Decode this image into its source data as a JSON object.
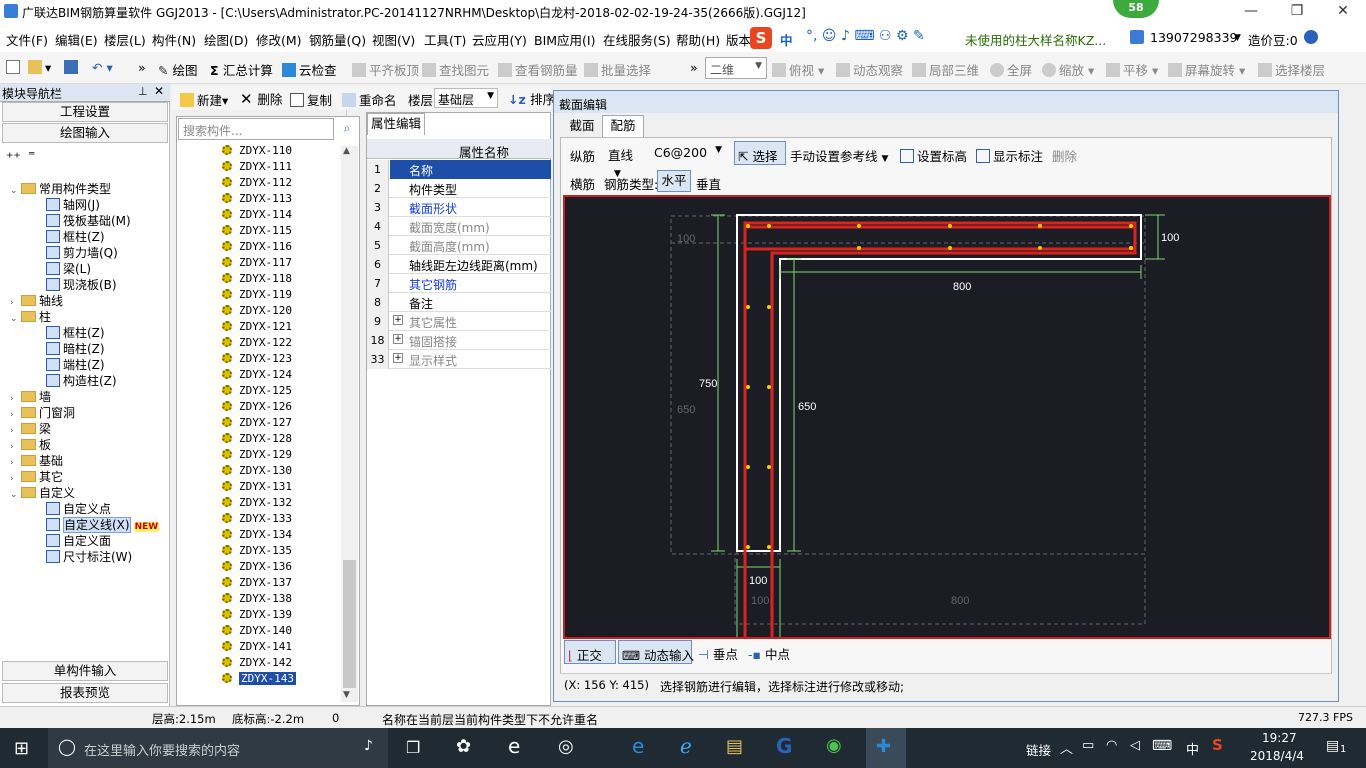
{
  "window": {
    "title": "广联达BIM钢筋算量软件 GGJ2013 - [C:\\Users\\Administrator.PC-20141127NRHM\\Desktop\\白龙村-2018-02-02-19-24-35(2666版).GGJ12]",
    "badge": "58",
    "minimize": "—",
    "maximize": "❐",
    "close": "✕"
  },
  "menu": {
    "items": [
      "文件(F)",
      "编辑(E)",
      "楼层(L)",
      "构件(N)",
      "绘图(D)",
      "修改(M)",
      "钢筋量(Q)",
      "视图(V)",
      "工具(T)",
      "云应用(Y)",
      "BIM应用(I)",
      "在线服务(S)",
      "帮助(H)",
      "版本"
    ],
    "ime_label": "中",
    "notice": "未使用的柱大样名称KZ...",
    "phone": "13907298339",
    "price": "造价豆:0"
  },
  "toolbar": {
    "draw": "绘图",
    "sum": "汇总计算",
    "cloud_check": "云检查",
    "flush_top": "平齐板顶",
    "find": "查找图元",
    "view_rebar": "查看钢筋量",
    "batch_select": "批量选择",
    "view_mode": "二维",
    "top_view": "俯视",
    "dyn_observe": "动态观察",
    "local_3d": "局部三维",
    "fullscreen": "全屏",
    "zoom": "缩放",
    "pan": "平移",
    "rotate": "屏幕旋转",
    "select_floor": "选择楼层"
  },
  "left_panel": {
    "title": "模块导航栏",
    "project_settings": "工程设置",
    "draw_input": "绘图输入",
    "single_input": "单构件输入",
    "report": "报表预览",
    "tree": [
      {
        "label": "常用构件类型",
        "level": 0,
        "kind": "folder",
        "open": true
      },
      {
        "label": "轴网(J)",
        "level": 1,
        "kind": "item"
      },
      {
        "label": "筏板基础(M)",
        "level": 1,
        "kind": "item"
      },
      {
        "label": "框柱(Z)",
        "level": 1,
        "kind": "item"
      },
      {
        "label": "剪力墙(Q)",
        "level": 1,
        "kind": "item"
      },
      {
        "label": "梁(L)",
        "level": 1,
        "kind": "item"
      },
      {
        "label": "现浇板(B)",
        "level": 1,
        "kind": "item"
      },
      {
        "label": "轴线",
        "level": 0,
        "kind": "folder",
        "open": false
      },
      {
        "label": "柱",
        "level": 0,
        "kind": "folder",
        "open": true
      },
      {
        "label": "框柱(Z)",
        "level": 1,
        "kind": "item"
      },
      {
        "label": "暗柱(Z)",
        "level": 1,
        "kind": "item"
      },
      {
        "label": "端柱(Z)",
        "level": 1,
        "kind": "item"
      },
      {
        "label": "构造柱(Z)",
        "level": 1,
        "kind": "item"
      },
      {
        "label": "墙",
        "level": 0,
        "kind": "folder",
        "open": false
      },
      {
        "label": "门窗洞",
        "level": 0,
        "kind": "folder",
        "open": false
      },
      {
        "label": "梁",
        "level": 0,
        "kind": "folder",
        "open": false
      },
      {
        "label": "板",
        "level": 0,
        "kind": "folder",
        "open": false
      },
      {
        "label": "基础",
        "level": 0,
        "kind": "folder",
        "open": false
      },
      {
        "label": "其它",
        "level": 0,
        "kind": "folder",
        "open": false
      },
      {
        "label": "自定义",
        "level": 0,
        "kind": "folder",
        "open": true
      },
      {
        "label": "自定义点",
        "level": 1,
        "kind": "item"
      },
      {
        "label": "自定义线(X)",
        "level": 1,
        "kind": "item",
        "selected": true
      },
      {
        "label": "自定义面",
        "level": 1,
        "kind": "item"
      },
      {
        "label": "尺寸标注(W)",
        "level": 1,
        "kind": "item"
      }
    ],
    "new_tag": "NEW"
  },
  "component_toolbar": {
    "new": "新建",
    "delete": "删除",
    "copy": "复制",
    "rename": "重命名",
    "floor_label": "楼层",
    "floor_value": "基础层",
    "sort": "排序"
  },
  "component_list": {
    "search_placeholder": "搜索构件...",
    "items": [
      "ZDYX-110",
      "ZDYX-111",
      "ZDYX-112",
      "ZDYX-113",
      "ZDYX-114",
      "ZDYX-115",
      "ZDYX-116",
      "ZDYX-117",
      "ZDYX-118",
      "ZDYX-119",
      "ZDYX-120",
      "ZDYX-121",
      "ZDYX-122",
      "ZDYX-123",
      "ZDYX-124",
      "ZDYX-125",
      "ZDYX-126",
      "ZDYX-127",
      "ZDYX-128",
      "ZDYX-129",
      "ZDYX-130",
      "ZDYX-131",
      "ZDYX-132",
      "ZDYX-133",
      "ZDYX-134",
      "ZDYX-135",
      "ZDYX-136",
      "ZDYX-137",
      "ZDYX-138",
      "ZDYX-139",
      "ZDYX-140",
      "ZDYX-141",
      "ZDYX-142",
      "ZDYX-143"
    ],
    "selected": "ZDYX-143"
  },
  "properties": {
    "tab": "属性编辑",
    "header": "属性名称",
    "rows": [
      {
        "num": "1",
        "name": "名称",
        "style": "selected"
      },
      {
        "num": "2",
        "name": "构件类型",
        "style": "normal"
      },
      {
        "num": "3",
        "name": "截面形状",
        "style": "blue"
      },
      {
        "num": "4",
        "name": "截面宽度(mm)",
        "style": "gray"
      },
      {
        "num": "5",
        "name": "截面高度(mm)",
        "style": "gray"
      },
      {
        "num": "6",
        "name": "轴线距左边线距离(mm)",
        "style": "normal"
      },
      {
        "num": "7",
        "name": "其它钢筋",
        "style": "blue"
      },
      {
        "num": "8",
        "name": "备注",
        "style": "normal"
      },
      {
        "num": "9",
        "name": "其它属性",
        "style": "expand"
      },
      {
        "num": "18",
        "name": "锚固搭接",
        "style": "expand"
      },
      {
        "num": "33",
        "name": "显示样式",
        "style": "expand"
      }
    ]
  },
  "section_editor": {
    "title": "截面编辑",
    "tabs": [
      "截面",
      "配筋"
    ],
    "active_tab": "配筋",
    "long_bar_label": "纵筋",
    "long_bar_type": "直线",
    "long_bar_spec": "C6@200",
    "select": "选择",
    "manual_ref": "手动设置参考线",
    "set_elevation": "设置标高",
    "show_dims": "显示标注",
    "delete": "删除",
    "trans_label": "横筋",
    "bar_type_label": "钢筋类型:",
    "horizontal": "水平",
    "vertical": "垂直",
    "dims": {
      "top_h": "100",
      "top_w": "800",
      "left_h": "750",
      "inner_h": "650",
      "bottom_w": "100",
      "ghost_w": "100",
      "ghost_h": "650",
      "ghost_bottom": "800",
      "ghost_bottom_w": "100"
    },
    "ortho": "正交",
    "dyn_input": "动态输入",
    "perp": "垂点",
    "mid": "中点",
    "coords": "(X: 156 Y: 415)",
    "hint": "选择钢筋进行编辑，选择标注进行修改或移动;"
  },
  "status": {
    "floor_height": "层高:2.15m",
    "bottom_elev": "底标高:-2.2m",
    "zero": "0",
    "message": "名称在当前层当前构件类型下不允许重名",
    "fps": "727.3 FPS"
  },
  "taskbar": {
    "search": "在这里输入你要搜索的内容",
    "link": "链接",
    "ime": "中",
    "time": "19:27",
    "date": "2018/4/4",
    "notif": "1"
  }
}
